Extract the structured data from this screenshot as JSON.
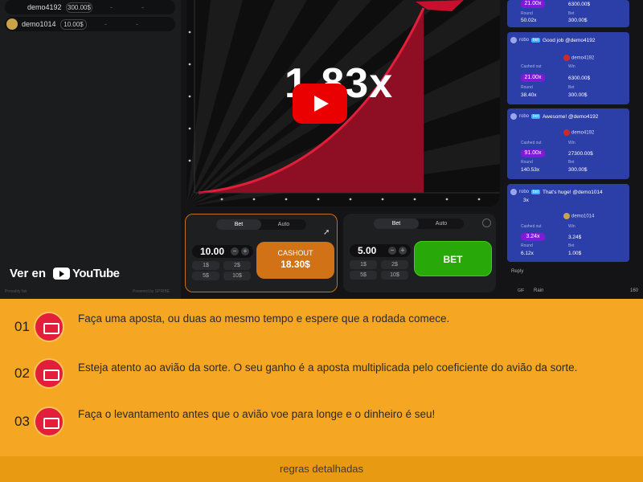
{
  "players": [
    {
      "name": "demo4192",
      "bet": "300.00$"
    },
    {
      "name": "demo1014",
      "bet": "10.00$"
    }
  ],
  "watch": {
    "label": "Ver en",
    "brand": "YouTube"
  },
  "footer_left": {
    "provably": "Provably fair",
    "powered": "Powered by SPRIBE"
  },
  "game": {
    "multiplier": "1.83x"
  },
  "panel1": {
    "tab_bet": "Bet",
    "tab_auto": "Auto",
    "amount": "10.00",
    "quick": [
      "1$",
      "2$",
      "5$",
      "10$"
    ],
    "cashout_label": "CASHOUT",
    "cashout_value": "18.30$"
  },
  "panel2": {
    "tab_bet": "Bet",
    "tab_auto": "Auto",
    "amount": "5.00",
    "quick": [
      "1$",
      "2$",
      "5$",
      "10$"
    ],
    "bet_label": "BET"
  },
  "chat": {
    "top": {
      "coef": "21.00x",
      "win": "6300.00$",
      "round_cap": "Round",
      "round": "50.02x",
      "bet_cap": "Bet",
      "bet": "300.00$"
    },
    "messages": [
      {
        "sender": "robo",
        "tag": "bot",
        "text": "Good job @demo4192",
        "user": "demo4192",
        "coef_cap": "Cashed out",
        "coef": "21.00x",
        "win_cap": "Win",
        "win": "6300.00$",
        "round_cap": "Round",
        "round": "38.40x",
        "bet_cap": "Bet",
        "bet": "300.00$"
      },
      {
        "sender": "robo",
        "tag": "bot",
        "text": "Awesome! @demo4192",
        "user": "demo4192",
        "coef_cap": "Cashed out",
        "coef": "91.00x",
        "win_cap": "Win",
        "win": "27300.00$",
        "round_cap": "Round",
        "round": "140.53x",
        "bet_cap": "Bet",
        "bet": "300.00$"
      },
      {
        "sender": "robo",
        "tag": "bot",
        "text": "That's huge! @demo1014",
        "extra": "3x",
        "user": "demo1014",
        "coef_cap": "Cashed out",
        "coef": "3.24x",
        "win_cap": "Win",
        "win": "3.24$",
        "round_cap": "Round",
        "round": "6.12x",
        "bet_cap": "Bet",
        "bet": "1.00$"
      }
    ],
    "reply": "Reply",
    "gif": "GIF",
    "rain": "Rain",
    "count": "160"
  },
  "instructions": {
    "steps": [
      {
        "num": "01",
        "text": "Faça uma aposta, ou duas ao mesmo tempo e espere que a rodada comece."
      },
      {
        "num": "02",
        "text": "Esteja atento ao avião da sorte. O seu ganho é a aposta multiplicada pelo coeficiente do avião da sorte."
      },
      {
        "num": "03",
        "text": "Faça o levantamento antes que o avião voe para longe e o dinheiro é seu!"
      }
    ],
    "rules_link": "regras detalhadas"
  },
  "colors": {
    "accent": "#f5a623",
    "cashout": "#d07215",
    "bet": "#28a909",
    "curve": "#e21e3b",
    "chat_card": "#2c3ea8"
  }
}
